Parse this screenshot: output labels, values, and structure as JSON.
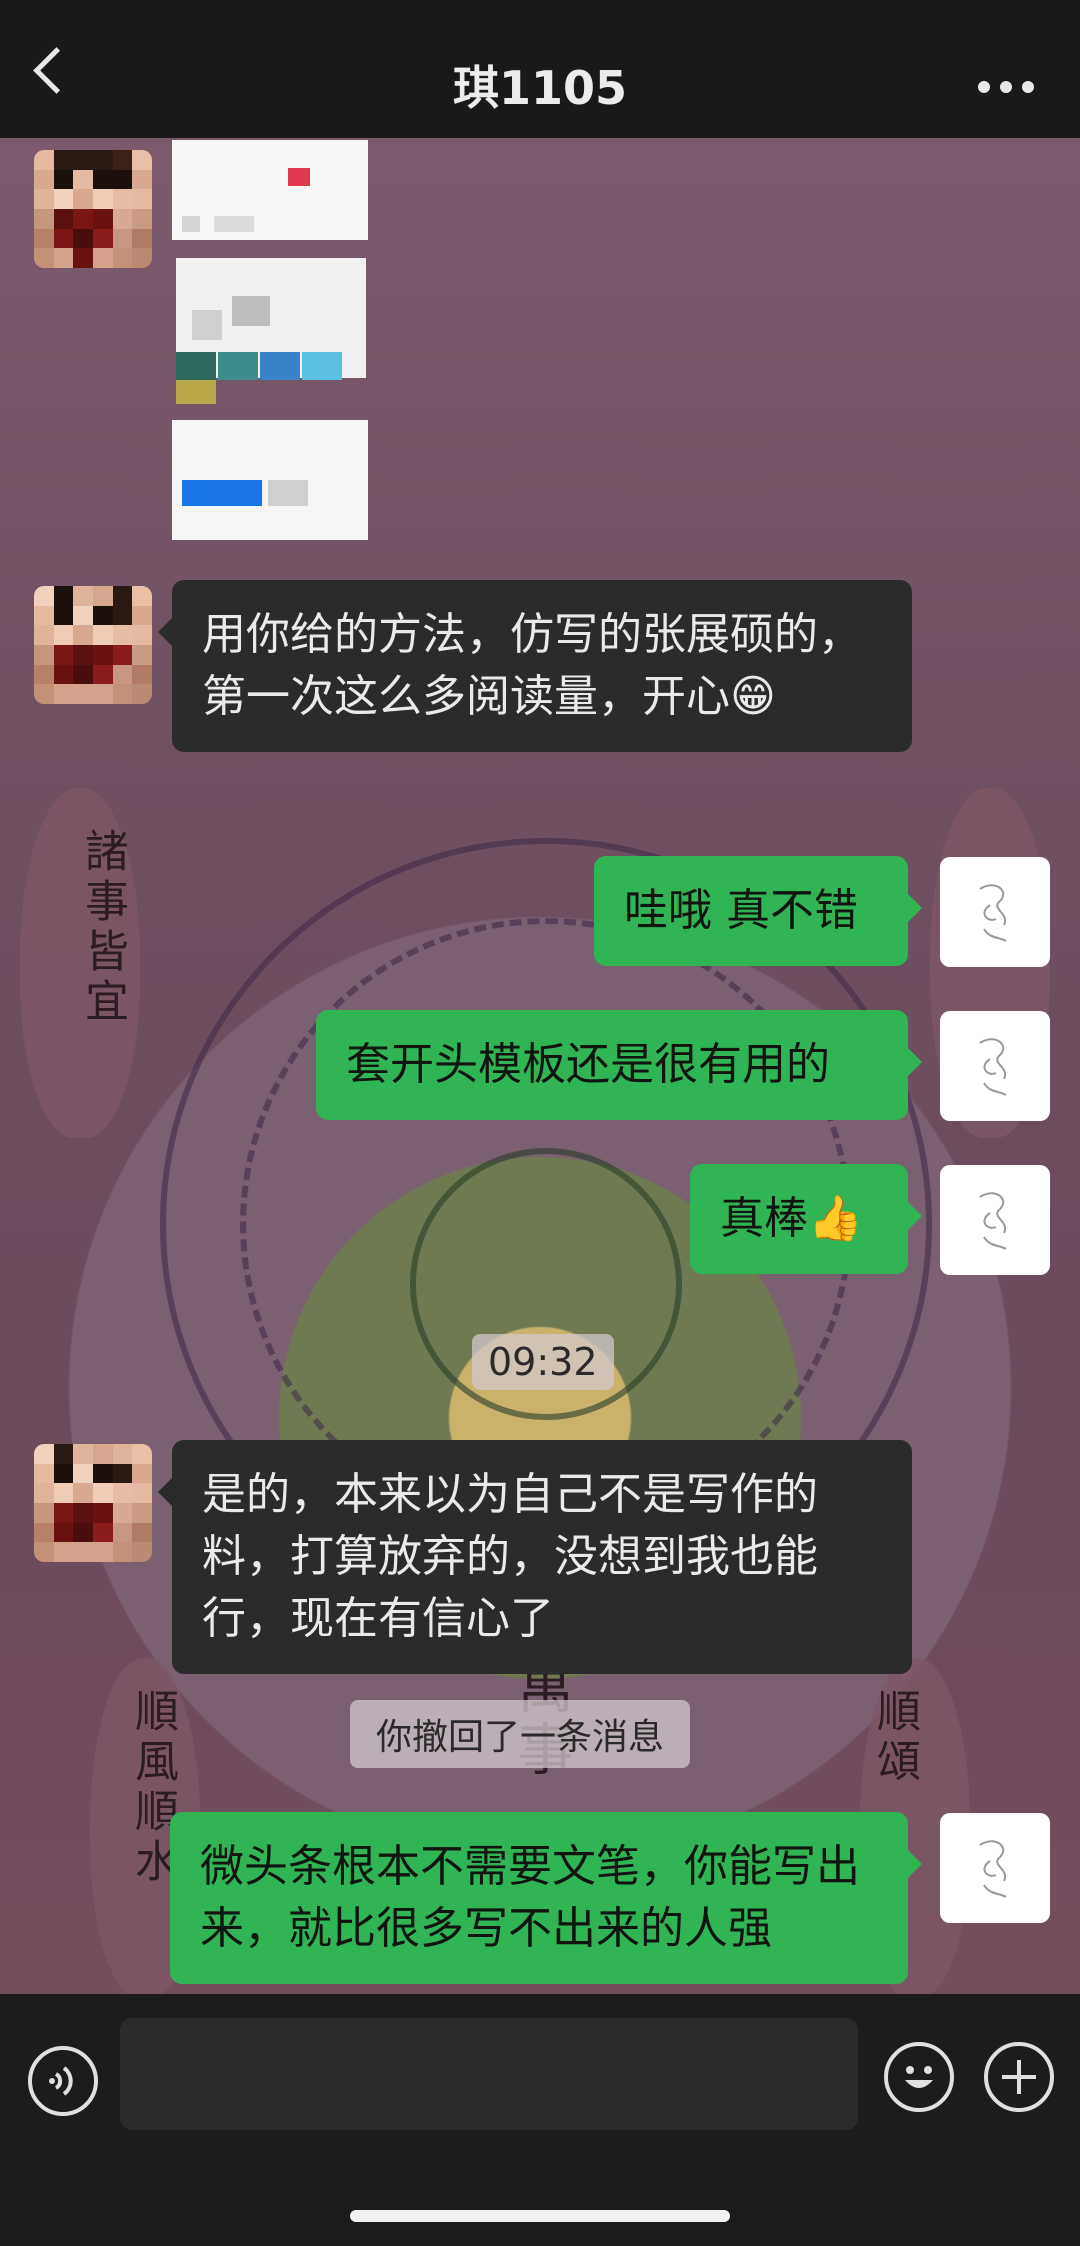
{
  "header": {
    "title": "琪1105"
  },
  "messages": [
    {
      "from": "other",
      "text": "用你给的方法，仿写的张展硕的，第一次这么多阅读量，开心😁"
    },
    {
      "from": "me",
      "text": "哇哦 真不错"
    },
    {
      "from": "me",
      "text": "套开头模板还是很有用的"
    },
    {
      "from": "me",
      "text": "真棒👍"
    },
    {
      "from": "other",
      "text": "是的，本来以为自己不是写作的料，打算放弃的，没想到我也能行，现在有信心了"
    },
    {
      "from": "me",
      "text": "微头条根本不需要文笔，你能写出来，就比很多写不出来的人强"
    }
  ],
  "timestamp": "09:32",
  "system_notice": "你撤回了一条消息",
  "wallpaper_text": {
    "left_top": "諸事皆宜",
    "left_bottom": "順風順水",
    "center": "萬事",
    "right_bottom": "順頌"
  }
}
